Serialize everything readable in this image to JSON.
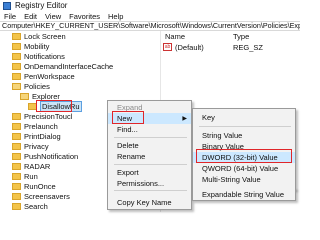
{
  "window": {
    "title": "Registry Editor",
    "app_icon": "registry-editor-icon"
  },
  "menubar": {
    "items": [
      "File",
      "Edit",
      "View",
      "Favorites",
      "Help"
    ]
  },
  "address": {
    "path": "Computer\\HKEY_CURRENT_USER\\Software\\Microsoft\\Windows\\CurrentVersion\\Policies\\Explorer\\DisallowRun"
  },
  "tree": {
    "items": [
      {
        "label": "Lock Screen"
      },
      {
        "label": "Mobility"
      },
      {
        "label": "Notifications"
      },
      {
        "label": "OnDemandInterfaceCache"
      },
      {
        "label": "PenWorkspace"
      },
      {
        "label": "Policies"
      },
      {
        "label": "Explorer"
      },
      {
        "label": "DisallowRun"
      },
      {
        "label": "PrecisionTouch"
      },
      {
        "label": "Prelaunch"
      },
      {
        "label": "Privacy"
      },
      {
        "label": "PushNotifications"
      },
      {
        "label": "RADAR"
      },
      {
        "label": "Run"
      },
      {
        "label": "RunOnce"
      },
      {
        "label": "Screensavers"
      },
      {
        "label": "Search"
      },
      {
        "label": "Security and M"
      },
      {
        "label": "SettingSync"
      },
      {
        "label": "Shell Extensions"
      }
    ],
    "truncated_prefix": {
      "precision": "PrecisionTouc",
      "prelaunch": "Prelaunch",
      "printdialog": "PrintDialog"
    }
  },
  "tree_visible": [
    "Lock Screen",
    "Mobility",
    "Notifications",
    "OnDemandInterfaceCache",
    "PenWorkspace",
    "Policies",
    "Explorer",
    "DisallowRu",
    "PrecisionToucl",
    "Prelaunch",
    "PrintDialog",
    "Privacy",
    "PushNotification",
    "RADAR",
    "Run",
    "RunOnce",
    "Screensavers",
    "Search",
    "Security and M",
    "SettingSync",
    "Shell Extensions"
  ],
  "values_pane": {
    "columns": {
      "name": "Name",
      "type": "Type"
    },
    "rows": [
      {
        "name": "(Default)",
        "type": "REG_SZ",
        "icon": "string-value-icon"
      }
    ]
  },
  "context_menu": {
    "items": [
      "Expand",
      "New",
      "Find...",
      "Delete",
      "Rename",
      "Export",
      "Permissions...",
      "Copy Key Name"
    ],
    "disabled": [
      "Expand"
    ],
    "highlighted": "New"
  },
  "submenu": {
    "items": [
      "Key",
      "String Value",
      "Binary Value",
      "DWORD (32-bit) Value",
      "QWORD (64-bit) Value",
      "Multi-String Value",
      "Expandable String Value"
    ],
    "highlighted": "DWORD (32-bit) Value"
  },
  "colors": {
    "highlight_border": "#e0262a",
    "selection": "#cce4f7",
    "menu_hover": "#cce8ff",
    "folder": "#f3c44a"
  }
}
